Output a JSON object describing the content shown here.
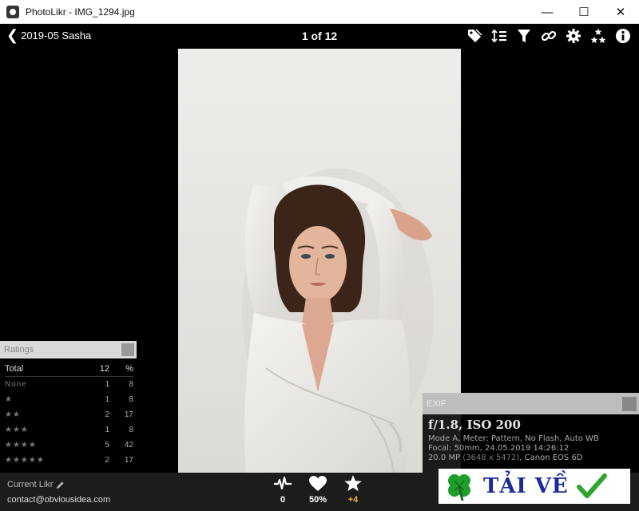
{
  "window": {
    "title": "PhotoLikr - IMG_1294.jpg",
    "minimize": "—",
    "maximize": "☐",
    "close": "✕"
  },
  "toolbar": {
    "back_label": "2019-05 Sasha",
    "counter": "1 of 12",
    "icons": [
      "tag-icon",
      "sort-icon",
      "filter-icon",
      "link-icon",
      "gear-icon",
      "stars-icon",
      "info-icon"
    ]
  },
  "ratings": {
    "title": "Ratings",
    "total_label": "Total",
    "total_count": "12",
    "pct_header": "%",
    "rows": [
      {
        "label": "None",
        "count": "1",
        "pct": "8"
      },
      {
        "label": "★",
        "count": "1",
        "pct": "8"
      },
      {
        "label": "★★",
        "count": "2",
        "pct": "17"
      },
      {
        "label": "★★★",
        "count": "1",
        "pct": "8"
      },
      {
        "label": "★★★★",
        "count": "5",
        "pct": "42"
      },
      {
        "label": "★★★★★",
        "count": "2",
        "pct": "17"
      }
    ]
  },
  "exif": {
    "title": "EXIF",
    "headline": "f/1.8, ISO 200",
    "line1": "Mode A, Meter: Pattern, No Flash, Auto WB",
    "line2": "Focal: 50mm, 24.05.2019 14:26:12",
    "line3_a": "20.0 MP",
    "line3_b": "(3648 x 5472)",
    "line3_c": ", Canon EOS 6D"
  },
  "bottom": {
    "current_label": "Current Likr",
    "email": "contact@obviousidea.com",
    "stats": {
      "activity": "0",
      "likes": "50%",
      "stars": "+4"
    }
  },
  "banner": {
    "text": "TẢI VỀ"
  },
  "colors": {
    "gold": "#e8b84a",
    "banner_blue": "#1a2a9a",
    "check_green": "#2ea52e",
    "clover_green": "#1f9e2a"
  }
}
